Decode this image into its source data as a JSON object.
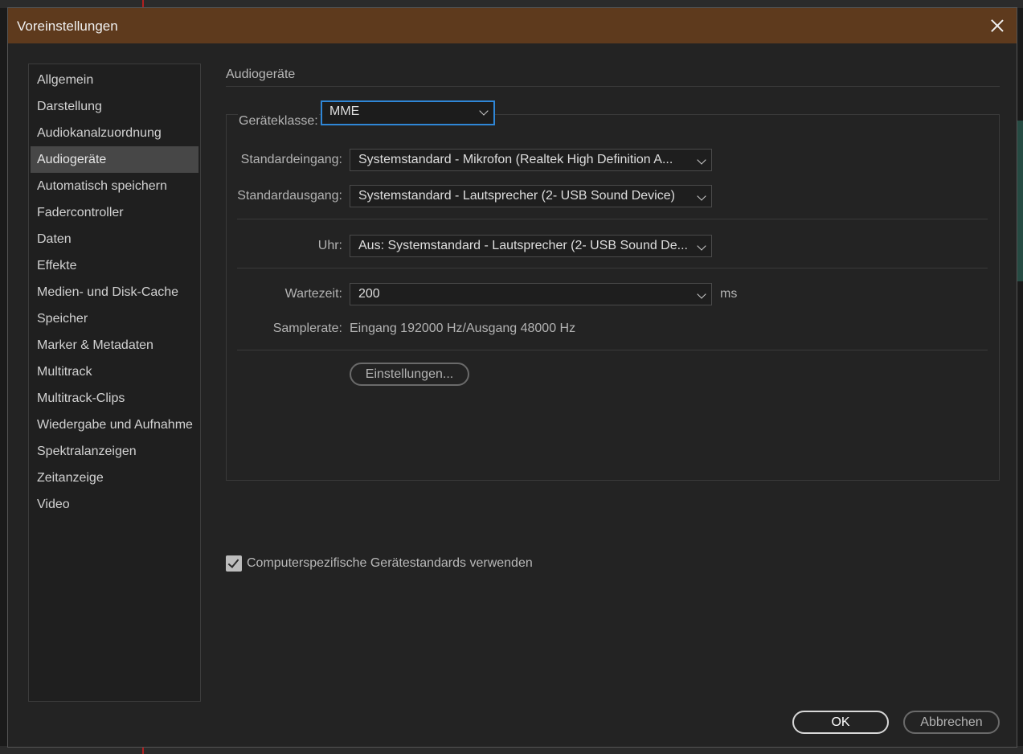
{
  "dialog": {
    "title": "Voreinstellungen",
    "close_icon": "close-icon"
  },
  "sidebar": {
    "items": [
      {
        "label": "Allgemein",
        "active": false
      },
      {
        "label": "Darstellung",
        "active": false
      },
      {
        "label": "Audiokanalzuordnung",
        "active": false
      },
      {
        "label": "Audiogeräte",
        "active": true
      },
      {
        "label": "Automatisch speichern",
        "active": false
      },
      {
        "label": "Fadercontroller",
        "active": false
      },
      {
        "label": "Daten",
        "active": false
      },
      {
        "label": "Effekte",
        "active": false
      },
      {
        "label": "Medien- und Disk-Cache",
        "active": false
      },
      {
        "label": "Speicher",
        "active": false
      },
      {
        "label": "Marker & Metadaten",
        "active": false
      },
      {
        "label": "Multitrack",
        "active": false
      },
      {
        "label": "Multitrack-Clips",
        "active": false
      },
      {
        "label": "Wiedergabe und Aufnahme",
        "active": false
      },
      {
        "label": "Spektralanzeigen",
        "active": false
      },
      {
        "label": "Zeitanzeige",
        "active": false
      },
      {
        "label": "Video",
        "active": false
      }
    ]
  },
  "main": {
    "section_title": "Audiogeräte",
    "device_class": {
      "label": "Geräteklasse:",
      "value": "MME"
    },
    "default_input": {
      "label": "Standardeingang:",
      "value": "Systemstandard - Mikrofon (Realtek High Definition A..."
    },
    "default_output": {
      "label": "Standardausgang:",
      "value": "Systemstandard - Lautsprecher (2- USB Sound Device)"
    },
    "clock": {
      "label": "Uhr:",
      "value": "Aus: Systemstandard - Lautsprecher (2- USB Sound De..."
    },
    "latency": {
      "label": "Wartezeit:",
      "value": "200",
      "unit": "ms"
    },
    "samplerate": {
      "label": "Samplerate:",
      "value": "Eingang 192000 Hz/Ausgang 48000 Hz"
    },
    "settings_button": "Einstellungen...",
    "checkbox": {
      "label": "Computerspezifische Gerätestandards verwenden",
      "checked": true
    }
  },
  "footer": {
    "ok": "OK",
    "cancel": "Abbrechen"
  },
  "colors": {
    "titlebar": "#5e3a1d",
    "focus": "#2f86d6",
    "background": "#232323"
  }
}
